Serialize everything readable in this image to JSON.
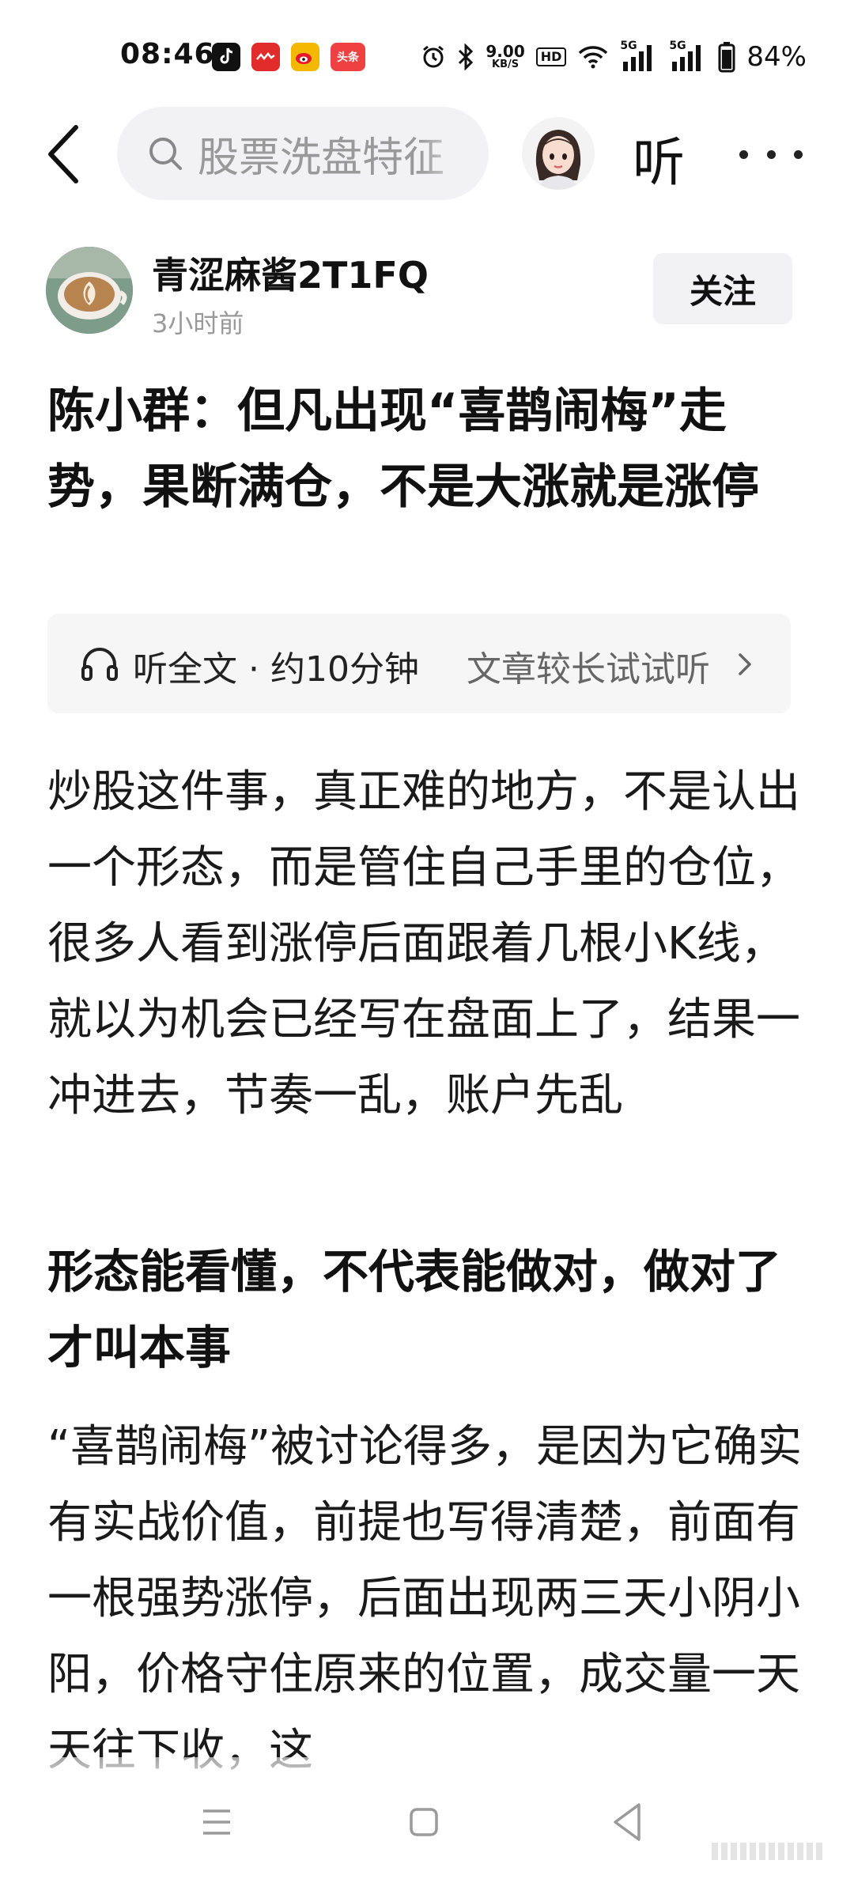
{
  "status_bar": {
    "time": "08:46",
    "net_speed_value": "9.00",
    "net_speed_unit": "KB/S",
    "hd_label": "HD",
    "network_label_1": "5G",
    "network_label_2": "5G",
    "battery": "84%",
    "toutiao_label": "头条",
    "icons": [
      "tiktok-icon",
      "red-app-icon",
      "weibo-icon",
      "toutiao-icon",
      "alarm-icon",
      "bluetooth-icon",
      "wifi-icon",
      "signal-icon",
      "signal-icon",
      "battery-icon"
    ]
  },
  "nav": {
    "search_text": "股票洗盘特征",
    "listen_label": "听"
  },
  "author": {
    "name": "青涩麻酱2T1FQ",
    "time": "3小时前",
    "follow_label": "关注"
  },
  "article": {
    "title": "陈小群：但凡出现“喜鹊闹梅”走势，果断满仓，不是大涨就是涨停",
    "listen_full": "听全文 · 约10分钟",
    "try_listen": "文章较长试试听",
    "paragraph1": "炒股这件事，真正难的地方，不是认出一个形态，而是管住自己手里的仓位，很多人看到涨停后面跟着几根小K线，就以为机会已经写在盘面上了，结果一冲进去，节奏一乱，账户先乱",
    "subheading": "形态能看懂，不代表能做对，做对了才叫本事",
    "paragraph2": "“喜鹊闹梅”被讨论得多，是因为它确实有实战价值，前提也写得清楚，前面有一根强势涨停，后面出现两三天小阴小阳，价格守住原来的位置，成交量一天天往下收，这"
  },
  "colors": {
    "search_bg": "#f2f2f4",
    "follow_bg": "#f2f2f4",
    "listen_bar_bg": "#f6f6f7",
    "secondary_text": "#999999"
  }
}
